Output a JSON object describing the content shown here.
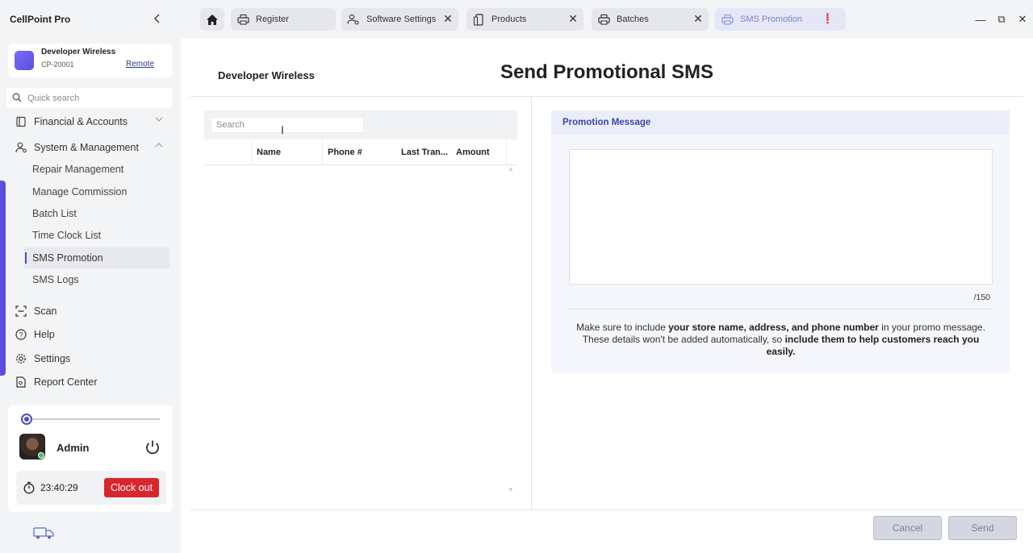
{
  "app": {
    "title": "CellPoint Pro"
  },
  "store": {
    "name": "Developer Wireless",
    "id": "CP-20001",
    "remote_label": "Remote"
  },
  "quick_search": {
    "placeholder": "Quick search"
  },
  "nav": {
    "financial": "Financial & Accounts",
    "system": "System & Management",
    "sub_items": [
      "Repair Management",
      "Manage Commission",
      "Batch List",
      "Time Clock List",
      "SMS Promotion",
      "SMS Logs"
    ],
    "active_sub": "SMS Promotion",
    "scan": "Scan",
    "help": "Help",
    "settings": "Settings",
    "report_center": "Report Center"
  },
  "user": {
    "name": "Admin",
    "clock_time": "23:40:29",
    "clockout_label": "Clock out",
    "slider_level": 0.0
  },
  "tabs": [
    {
      "label": "Register",
      "icon": "printer-icon",
      "closable": false
    },
    {
      "label": "Software Settings",
      "icon": "user-settings-icon",
      "closable": true
    },
    {
      "label": "Products",
      "icon": "phone-icon",
      "closable": true
    },
    {
      "label": "Batches",
      "icon": "printer-icon",
      "closable": true
    },
    {
      "label": "SMS Promotion",
      "icon": "printer-icon",
      "closable": true,
      "active": true
    }
  ],
  "window_controls": {
    "minimize": "—",
    "restore": "⧉",
    "close": "✕"
  },
  "page": {
    "store_header": "Developer Wireless",
    "title": "Send Promotional SMS"
  },
  "customers": {
    "search_placeholder": "Search",
    "columns": [
      "",
      "Name",
      "Phone #",
      "Last Tran...",
      "Amount"
    ],
    "rows": []
  },
  "promotion": {
    "header": "Promotion Message",
    "message_value": "",
    "char_count": "/150",
    "note_pre": "Make sure to include ",
    "note_bold1": "your store name, address, and phone number",
    "note_mid": " in your promo message. These details won't be added automatically, so ",
    "note_bold2": "include them to help customers reach you easily."
  },
  "actions": {
    "cancel": "Cancel",
    "send": "Send"
  },
  "colors": {
    "accent": "#4a4fc4",
    "danger": "#d7262d",
    "sidebar_bg": "#f3f4f6"
  }
}
